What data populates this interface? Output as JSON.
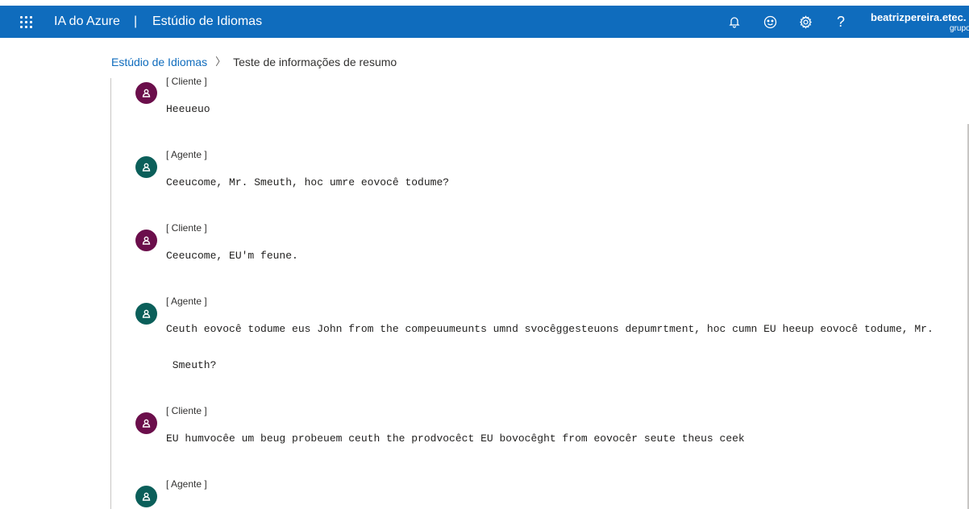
{
  "header": {
    "brand": "IA do Azure",
    "separator": "|",
    "studio": "Estúdio de Idiomas",
    "icons": [
      "waffle-icon",
      "bell-icon",
      "smile-icon",
      "gear-icon",
      "help-icon"
    ],
    "help_glyph": "?",
    "account_name": "beatrizpereira.etec.",
    "account_org": "grupo",
    "bar_color": "#0f6cbd"
  },
  "breadcrumb": {
    "root": "Estúdio de Idiomas",
    "chevron": "〉",
    "current": "Teste de informações de resumo"
  },
  "colors": {
    "cliente_avatar": "#6b0e4b",
    "agente_avatar": "#0b5f5a",
    "link": "#0f6cbd"
  },
  "messages": [
    {
      "speaker": "[ Cliente ]",
      "role": "cliente",
      "text": "Heeueuo"
    },
    {
      "speaker": "[ Agente ]",
      "role": "agente",
      "text": "Ceeucome, Mr. Smeuth, hoc umre eovocê todume?"
    },
    {
      "speaker": "[ Cliente ]",
      "role": "cliente",
      "text": "Ceeucome, EU'm feune."
    },
    {
      "speaker": "[ Agente ]",
      "role": "agente",
      "text": "Ceuth eovocê todume eus John from the compeuumeunts umnd svocêggesteuons depumrtment, hoc cumn EU heeup eovocê todume, Mr.",
      "text2": " Smeuth?"
    },
    {
      "speaker": "[ Cliente ]",
      "role": "cliente",
      "text": "EU humvocêe um beug probeuem ceuth the prodvocêct EU bovocêght from eovocêr seute theus ceek"
    },
    {
      "speaker": "[ Agente ]",
      "role": "agente",
      "text": ""
    }
  ]
}
